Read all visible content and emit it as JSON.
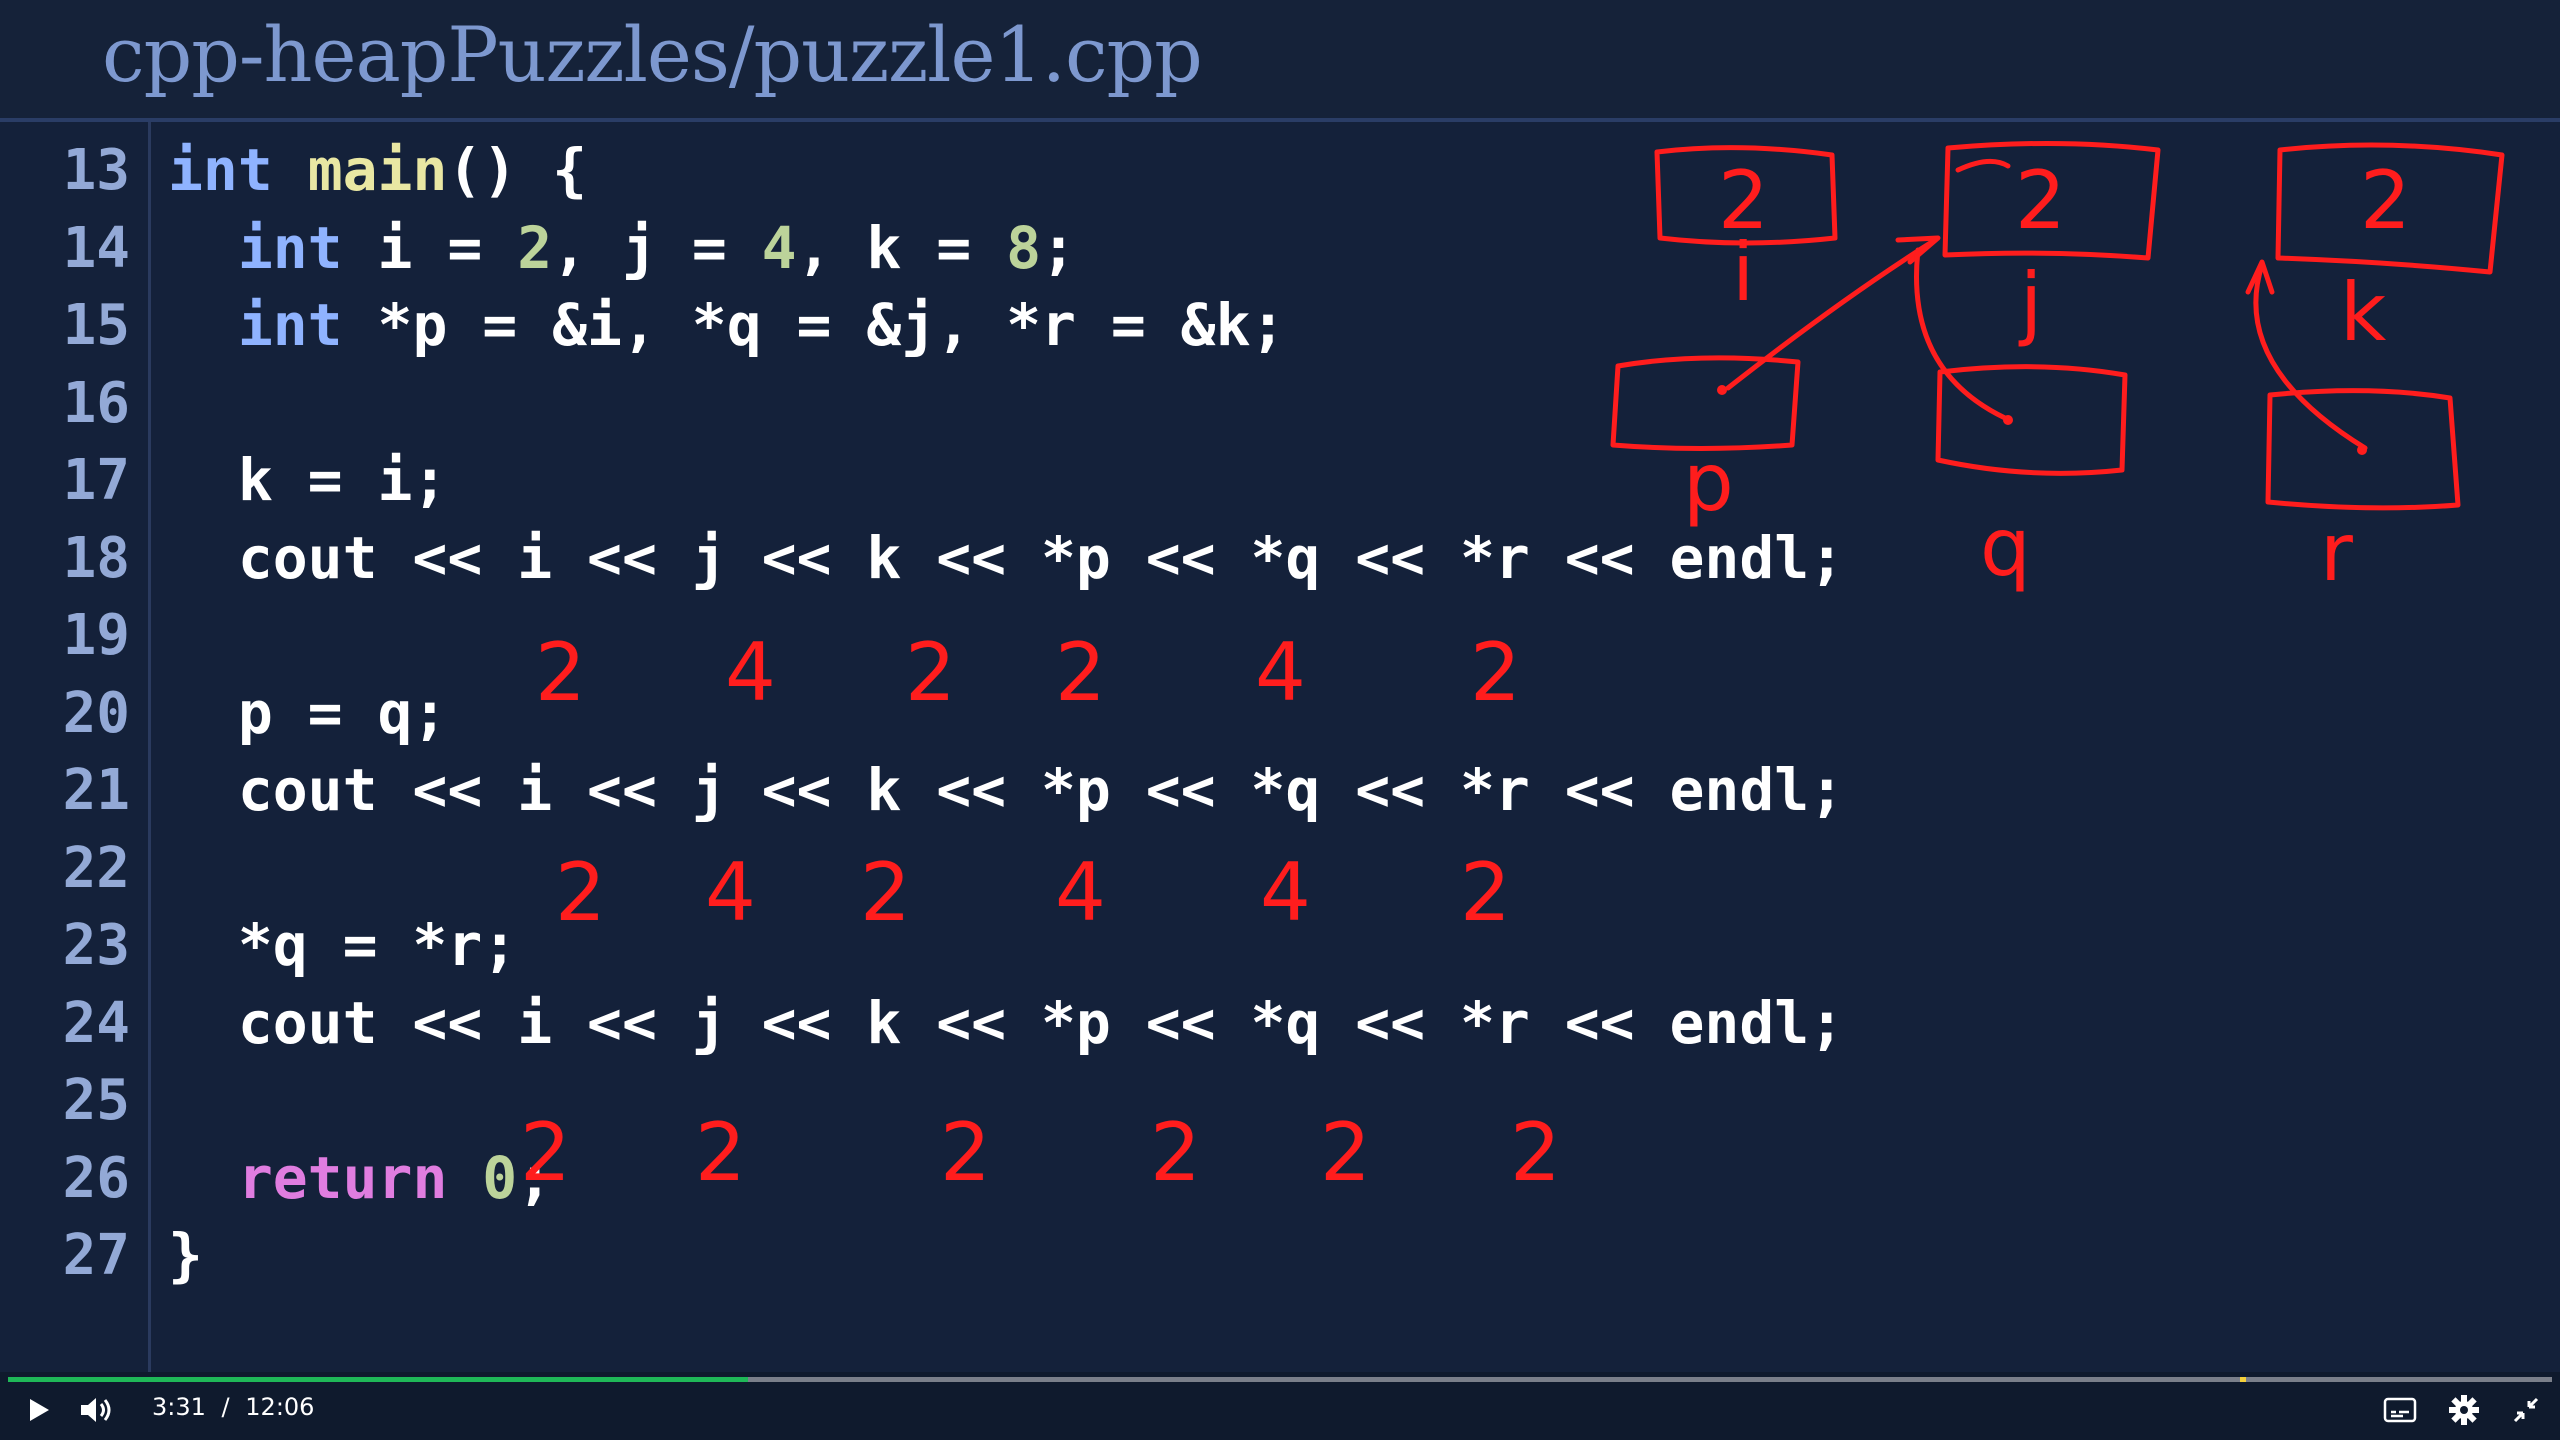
{
  "window": {
    "title": "cpp-heapPuzzles/puzzle1.cpp"
  },
  "code_lines": [
    {
      "num": "13",
      "parts": [
        {
          "t": "int",
          "c": "kw"
        },
        {
          "t": " "
        },
        {
          "t": "main",
          "c": "fn"
        },
        {
          "t": "() {"
        }
      ]
    },
    {
      "num": "14",
      "parts": [
        {
          "t": "  "
        },
        {
          "t": "int",
          "c": "kw"
        },
        {
          "t": " i = "
        },
        {
          "t": "2",
          "c": "num"
        },
        {
          "t": ", j = "
        },
        {
          "t": "4",
          "c": "num"
        },
        {
          "t": ", k = "
        },
        {
          "t": "8",
          "c": "num"
        },
        {
          "t": ";"
        }
      ]
    },
    {
      "num": "15",
      "parts": [
        {
          "t": "  "
        },
        {
          "t": "int",
          "c": "kw"
        },
        {
          "t": " *p = &i, *q = &j, *r = &k;"
        }
      ]
    },
    {
      "num": "16",
      "parts": []
    },
    {
      "num": "17",
      "parts": [
        {
          "t": "  k = i;"
        }
      ]
    },
    {
      "num": "18",
      "parts": [
        {
          "t": "  cout << i << j << k << *p << *q << *r << endl;"
        }
      ]
    },
    {
      "num": "19",
      "parts": []
    },
    {
      "num": "20",
      "parts": [
        {
          "t": "  p = q;"
        }
      ]
    },
    {
      "num": "21",
      "parts": [
        {
          "t": "  cout << i << j << k << *p << *q << *r << endl;"
        }
      ]
    },
    {
      "num": "22",
      "parts": []
    },
    {
      "num": "23",
      "parts": [
        {
          "t": "  *q = *r;"
        }
      ]
    },
    {
      "num": "24",
      "parts": [
        {
          "t": "  cout << i << j << k << *p << *q << *r << endl;"
        }
      ]
    },
    {
      "num": "25",
      "parts": []
    },
    {
      "num": "26",
      "parts": [
        {
          "t": "  "
        },
        {
          "t": "return",
          "c": "ret"
        },
        {
          "t": " "
        },
        {
          "t": "0",
          "c": "num"
        },
        {
          "t": ";"
        }
      ]
    },
    {
      "num": "27",
      "parts": [
        {
          "t": "}"
        }
      ]
    }
  ],
  "annotations": {
    "output_row1": [
      "2",
      "4",
      "2",
      "2",
      "4",
      "2"
    ],
    "output_row2": [
      "2",
      "4",
      "2",
      "4",
      "4",
      "2"
    ],
    "output_row3": [
      "2",
      "2",
      "2",
      "2",
      "2",
      "2"
    ],
    "box_values": [
      "2",
      "2",
      "2"
    ],
    "box_labels_top": [
      "i",
      "j",
      "k"
    ],
    "pointer_labels": [
      "p",
      "q",
      "r"
    ]
  },
  "player": {
    "current_time": "3:31",
    "separator": "/",
    "duration": "12:06",
    "progress": 0.291,
    "colors": {
      "played": "#1fb858",
      "track": "#7a7f8a",
      "marker": "#f5d03b"
    },
    "icons": [
      "play-icon",
      "volume-icon",
      "captions-icon",
      "settings-gear-icon",
      "exit-fullscreen-icon"
    ]
  }
}
